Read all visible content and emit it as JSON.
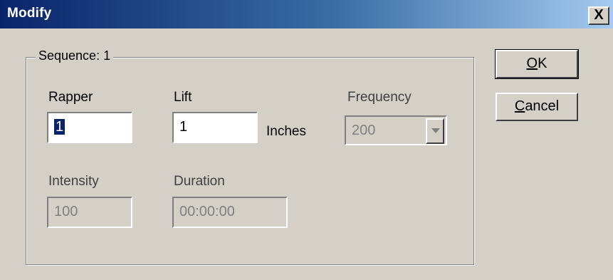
{
  "window": {
    "title": "Modify",
    "close_glyph": "X"
  },
  "group": {
    "title": "Sequence: 1"
  },
  "rapper": {
    "label": "Rapper",
    "value": "1"
  },
  "lift": {
    "label": "Lift",
    "value": "1",
    "unit": "Inches"
  },
  "frequency": {
    "label": "Frequency",
    "value": "200"
  },
  "intensity": {
    "label": "Intensity",
    "value": "100"
  },
  "duration": {
    "label": "Duration",
    "value": "00:00:00"
  },
  "buttons": {
    "ok": {
      "accel": "O",
      "rest": "K"
    },
    "cancel": {
      "accel": "C",
      "rest": "ancel"
    }
  }
}
